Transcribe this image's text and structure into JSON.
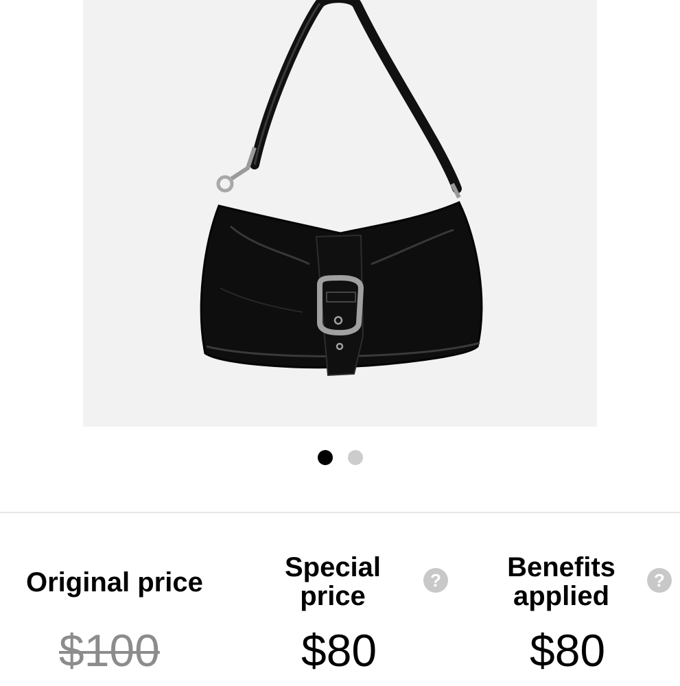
{
  "product": {
    "image_alt": "black leather shoulder bag with buckle",
    "image_background": "#f2f2f2"
  },
  "carousel": {
    "total_slides": 2,
    "active_index": 0,
    "active_color": "#000000",
    "inactive_color": "#cccccc"
  },
  "pricing": {
    "original": {
      "label": "Original price",
      "value": "$100"
    },
    "special": {
      "label_line1": "Special",
      "label_line2": "price",
      "value": "$80",
      "help_icon": "question-circle-icon",
      "help_glyph": "?"
    },
    "benefits": {
      "label_line1": "Benefits",
      "label_line2": "applied",
      "value": "$80",
      "help_icon": "question-circle-icon",
      "help_glyph": "?"
    },
    "strike_color": "#8c8c8c"
  }
}
